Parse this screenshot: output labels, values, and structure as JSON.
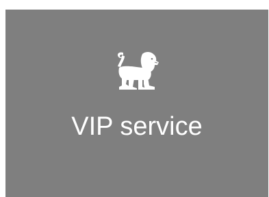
{
  "tile": {
    "icon": "lion-icon",
    "label": "VIP service",
    "background_color": "#7f7f7f",
    "text_color": "#ffffff"
  }
}
